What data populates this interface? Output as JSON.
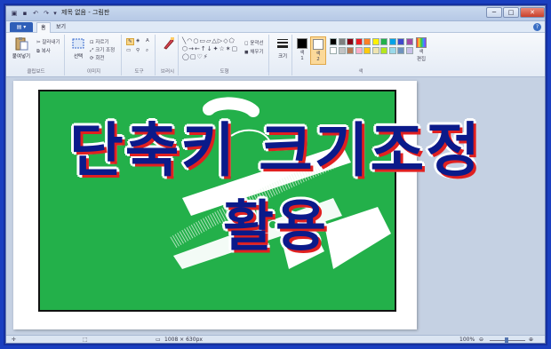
{
  "window": {
    "title": "제목 없음 - 그림판",
    "minimize": "─",
    "maximize": "□",
    "close": "✕"
  },
  "tabs": {
    "file": "",
    "home": "홈",
    "view": "보기",
    "help": "?"
  },
  "ribbon": {
    "clipboard": {
      "paste": "붙여넣기",
      "cut": "잘라내기",
      "copy": "복사",
      "label": "클립보드"
    },
    "image": {
      "select": "선택",
      "crop": "자르기",
      "resize": "크기 조정",
      "rotate": "회전",
      "label": "이미지"
    },
    "tools": {
      "label": "도구"
    },
    "brushes": {
      "label": "브러시"
    },
    "shapes": {
      "outline": "윤곽선",
      "fill": "채우기",
      "label": "도형"
    },
    "size": {
      "label": "크기"
    },
    "colors": {
      "color1": "색\n1",
      "color2": "색\n2",
      "edit": "색\n편집",
      "label": "색",
      "palette": [
        "#000000",
        "#7f7f7f",
        "#880015",
        "#ed1c24",
        "#ff7f27",
        "#fff200",
        "#22b14c",
        "#00a2e8",
        "#3f48cc",
        "#a349a4",
        "#ffffff",
        "#c3c3c3",
        "#b97a57",
        "#ffaec9",
        "#ffc90e",
        "#efe4b0",
        "#b5e61d",
        "#99d9ea",
        "#7092be",
        "#c8bfe7"
      ]
    }
  },
  "status": {
    "dimensions": "1008 × 630px",
    "zoom": "100%"
  },
  "overlay": {
    "line1": "단축키 크기조정",
    "line2": "활용"
  }
}
